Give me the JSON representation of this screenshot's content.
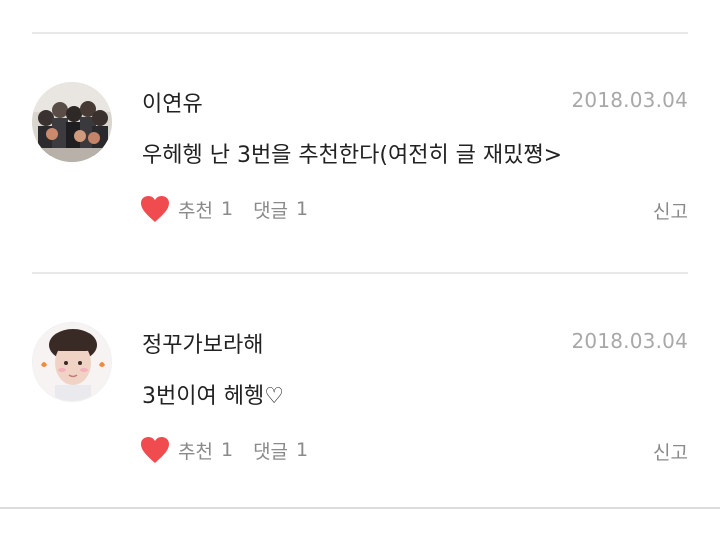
{
  "comments": [
    {
      "author": "이연유",
      "date": "2018.03.04",
      "text": "우헤헹 난 3번을 추천한다(여전히 글 재밌쪙>",
      "recommend_label": "추천",
      "recommend_count": "1",
      "reply_label": "댓글",
      "reply_count": "1",
      "report_label": "신고",
      "avatar_icon": "group-photo-avatar"
    },
    {
      "author": "정꾸가보라해",
      "date": "2018.03.04",
      "text": "3번이여 헤헹♡",
      "recommend_label": "추천",
      "recommend_count": "1",
      "reply_label": "댓글",
      "reply_count": "1",
      "report_label": "신고",
      "avatar_icon": "portrait-avatar"
    }
  ],
  "colors": {
    "heart": "#f04b4f",
    "muted_text": "#8a8a8a",
    "date_text": "#a8a8a8",
    "divider": "#e8e8e8"
  }
}
